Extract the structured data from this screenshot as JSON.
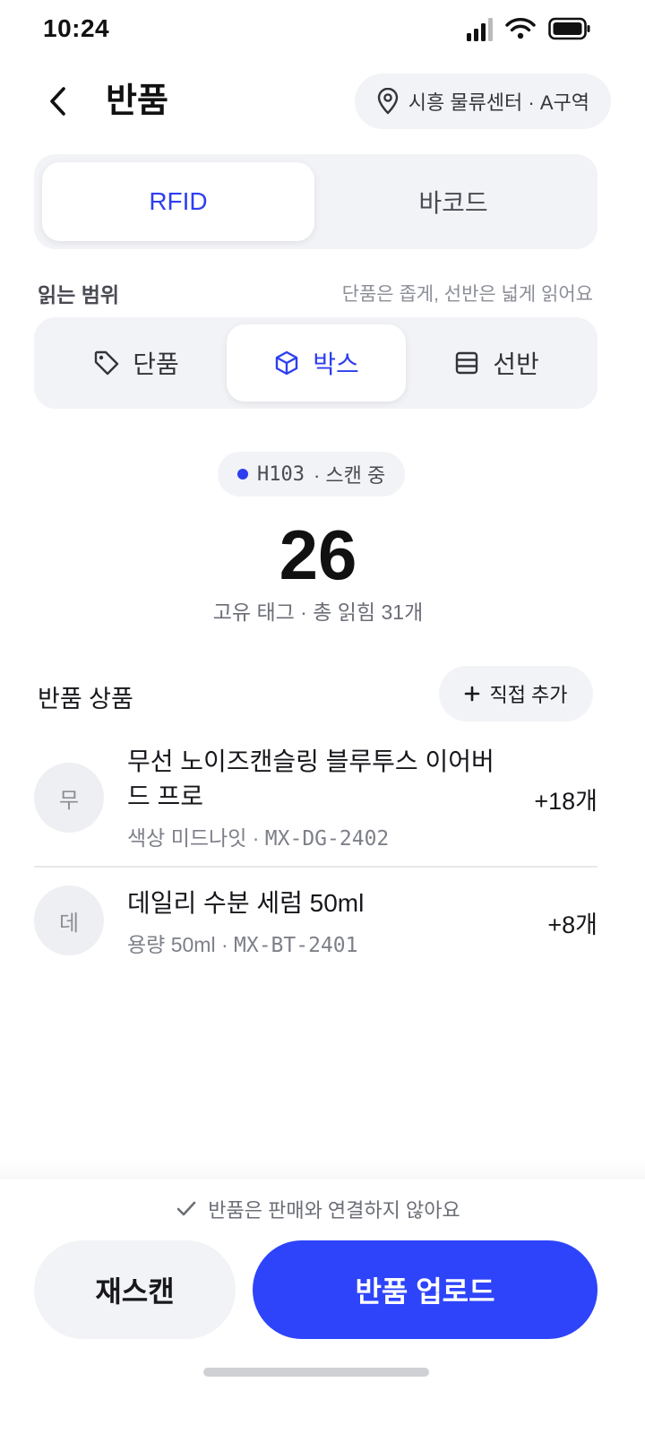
{
  "status_bar": {
    "time": "10:24"
  },
  "header": {
    "title": "반품",
    "location": "시흥 물류센터 · A구역"
  },
  "mode_tabs": [
    {
      "label": "RFID",
      "active": true
    },
    {
      "label": "바코드",
      "active": false
    }
  ],
  "read_range": {
    "label": "읽는 범위",
    "hint": "단품은 좁게, 선반은 넓게 읽어요",
    "options": [
      {
        "label": "단품",
        "icon": "tag-icon",
        "active": false
      },
      {
        "label": "박스",
        "icon": "box-icon",
        "active": true
      },
      {
        "label": "선반",
        "icon": "shelf-icon",
        "active": false
      }
    ]
  },
  "scan": {
    "reader_id": "H103",
    "status": "· 스캔 중",
    "unique_count": "26",
    "summary": "고유 태그 · 총 읽힘 31개"
  },
  "list": {
    "title": "반품 상품",
    "add_label": "직접 추가",
    "items": [
      {
        "initial": "무",
        "name": "무선 노이즈캔슬링 블루투스 이어버드 프로",
        "meta_prefix": "색상 미드나잇 · ",
        "sku": "MX-DG-2402",
        "qty": "+18개"
      },
      {
        "initial": "데",
        "name": "데일리 수분 세럼 50ml",
        "meta_prefix": "용량 50ml · ",
        "sku": "MX-BT-2401",
        "qty": "+8개"
      }
    ]
  },
  "footer": {
    "notice": "반품은 판매와 연결하지 않아요",
    "rescan_label": "재스캔",
    "upload_label": "반품 업로드"
  },
  "colors": {
    "accent": "#2e44fb",
    "surface": "#f2f3f6"
  }
}
